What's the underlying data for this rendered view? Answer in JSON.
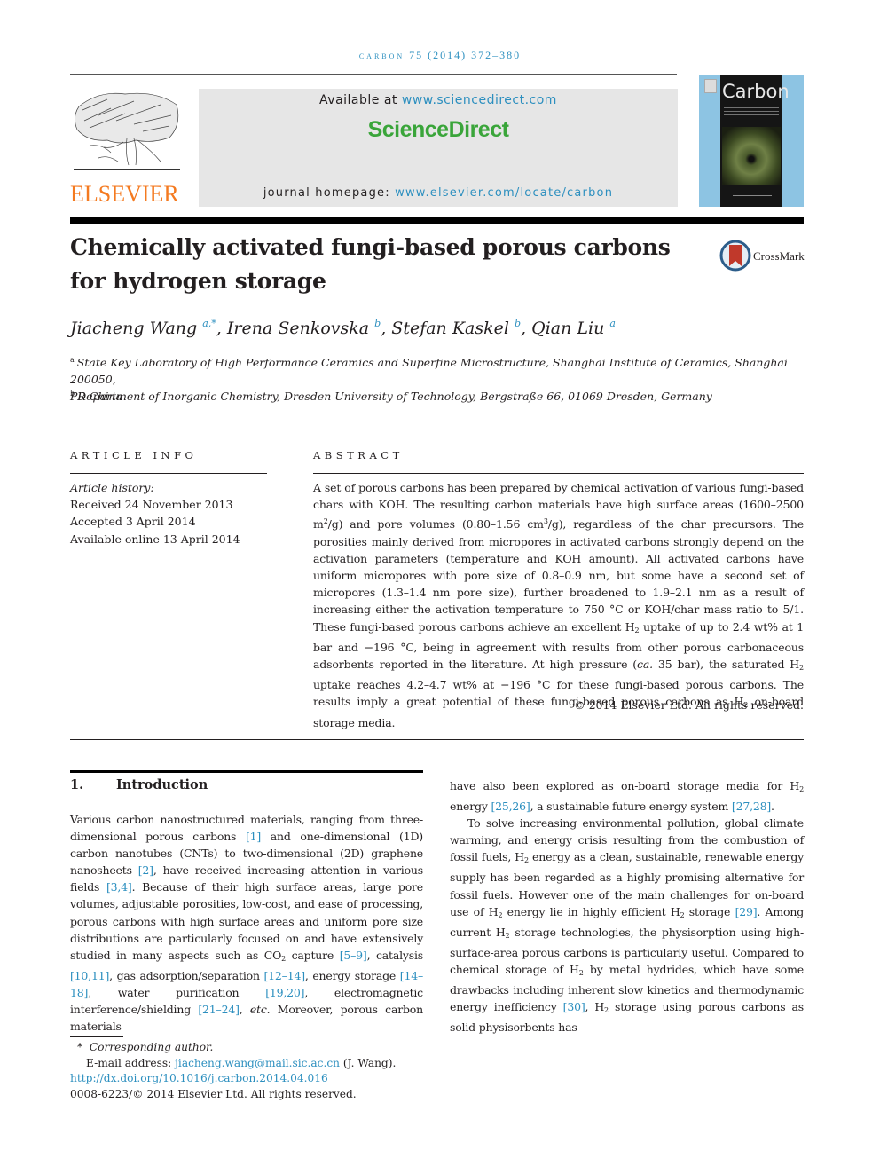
{
  "running_header": {
    "journal": "carbon",
    "citation": "75 (2014) 372–380"
  },
  "publisher": {
    "logo_word": "ELSEVIER",
    "banner": {
      "available_prefix": "Available at ",
      "available_link": "www.sciencedirect.com",
      "brand": "ScienceDirect",
      "homepage_prefix": "journal homepage: ",
      "homepage_link": "www.elsevier.com/locate/carbon"
    },
    "cover": {
      "title": "Carbon"
    }
  },
  "crossmark": {
    "label": "CrossMark"
  },
  "article": {
    "title_line1": "Chemically activated fungi-based porous carbons",
    "title_line2": "for hydrogen storage",
    "authors": [
      {
        "name": "Jiacheng Wang",
        "aff": "a,*",
        "sep": ", "
      },
      {
        "name": "Irena Senkovska",
        "aff": "b",
        "sep": ", "
      },
      {
        "name": "Stefan Kaskel",
        "aff": "b",
        "sep": ", "
      },
      {
        "name": "Qian Liu",
        "aff": "a",
        "sep": ""
      }
    ],
    "affiliations": [
      {
        "mark": "a",
        "line1": "State Key Laboratory of High Performance Ceramics and Superfine Microstructure, Shanghai Institute of Ceramics, Shanghai 200050,",
        "line2": "PR China"
      },
      {
        "mark": "b",
        "line1": "Department of Inorganic Chemistry, Dresden University of Technology, Bergstraße 66, 01069 Dresden, Germany"
      }
    ]
  },
  "article_info": {
    "heading": "ARTICLE INFO",
    "history_label": "Article history:",
    "received": "Received 24 November 2013",
    "accepted": "Accepted 3 April 2014",
    "online": "Available online 13 April 2014"
  },
  "abstract": {
    "heading": "ABSTRACT",
    "p1": "A set of porous carbons has been prepared by chemical activation of various fungi-based chars with KOH. The resulting carbon materials have high surface areas (1600–2500 m",
    "sup1": "2",
    "p2": "/g) and pore volumes (0.80–1.56 cm",
    "sup2": "3",
    "p3": "/g), regardless of the char precursors. The porosities mainly derived from micropores in activated carbons strongly depend on the activation parameters (temperature and KOH amount). All activated carbons have uniform micropores with pore size of 0.8–0.9 nm, but some have a second set of micropores (1.3–1.4 nm pore size), further broadened to 1.9–2.1 nm as a result of increasing either the activation temperature to 750 °C or KOH/char mass ratio to 5/1. These fungi-based porous carbons achieve an excellent H",
    "p4": " uptake of up to 2.4 wt% at 1 bar and −196 °C, being in agreement with results from other porous carbonaceous adsorbents reported in the literature. At high pressure (",
    "ca": "ca.",
    "p5": " 35 bar), the saturated H",
    "p6": " uptake reaches 4.2–4.7 wt% at −196 °C for these fungi-based porous carbons. The results imply a great potential of these fungi-based porous carbons as H",
    "p7": " on-board storage media.",
    "sub": "2",
    "copyright": "© 2014 Elsevier Ltd. All rights reserved."
  },
  "introduction": {
    "number": "1.",
    "heading": "Introduction",
    "left": [
      "Various carbon nanostructured materials, ranging from three-dimensional porous carbons ",
      "[1]",
      " and one-dimensional (1D) carbon nanotubes (CNTs) to two-dimensional (2D) graphene nanosheets ",
      "[2]",
      ", have received increasing attention in various fields ",
      "[3,4]",
      ". Because of their high surface areas, large pore volumes, adjustable porosities, low-cost, and ease of processing, porous carbons with high surface areas and uniform pore size distributions are particularly focused on and have extensively studied in many aspects such as CO",
      "2",
      " capture ",
      "[5–9]",
      ", catalysis ",
      "[10,11]",
      ", gas adsorption/separation ",
      "[12–14]",
      ", energy storage ",
      "[14–18]",
      ", water purification ",
      "[19,20]",
      ", electromagnetic interference/shielding ",
      "[21–24]",
      ", ",
      "etc.",
      " Moreover, porous carbon materials"
    ],
    "right_p1": [
      "have also been explored as on-board storage media for H",
      "2",
      " energy ",
      "[25,26]",
      ", a sustainable future energy system ",
      "[27,28]",
      "."
    ],
    "right_p2": [
      "To solve increasing environmental pollution, global climate warming, and energy crisis resulting from the combustion of fossil fuels, H",
      "2",
      " energy as a clean, sustainable, renewable energy supply has been regarded as a highly promising alternative for fossil fuels. However one of the main challenges for on-board use of H",
      "2",
      " energy lie in highly efficient H",
      "2",
      " storage ",
      "[29]",
      ". Among current H",
      "2",
      " storage technologies, the physisorption using high-surface-area porous carbons is particularly useful. Compared to chemical storage of H",
      "2",
      " by metal hydrides, which have some drawbacks including inherent slow kinetics and thermodynamic energy inefficiency ",
      "[30]",
      ", H",
      "2",
      " storage using porous carbons as solid physisorbents has"
    ]
  },
  "footnotes": {
    "mark": "*",
    "corresponding": "Corresponding author.",
    "email_label": "E-mail address: ",
    "email": "jiacheng.wang@mail.sic.ac.cn",
    "email_suffix": " (J. Wang).",
    "doi": "http://dx.doi.org/10.1016/j.carbon.2014.04.016",
    "issn": "0008-6223/© 2014 Elsevier Ltd. All rights reserved."
  },
  "colors": {
    "link": "#2c8fbf",
    "elsevier_orange": "#f47a20",
    "sciencedirect_green": "#3aa53a",
    "banner_grey": "#e6e6e6",
    "cover_blue": "#8dc4e3",
    "crossmark_red": "#c0392b"
  }
}
